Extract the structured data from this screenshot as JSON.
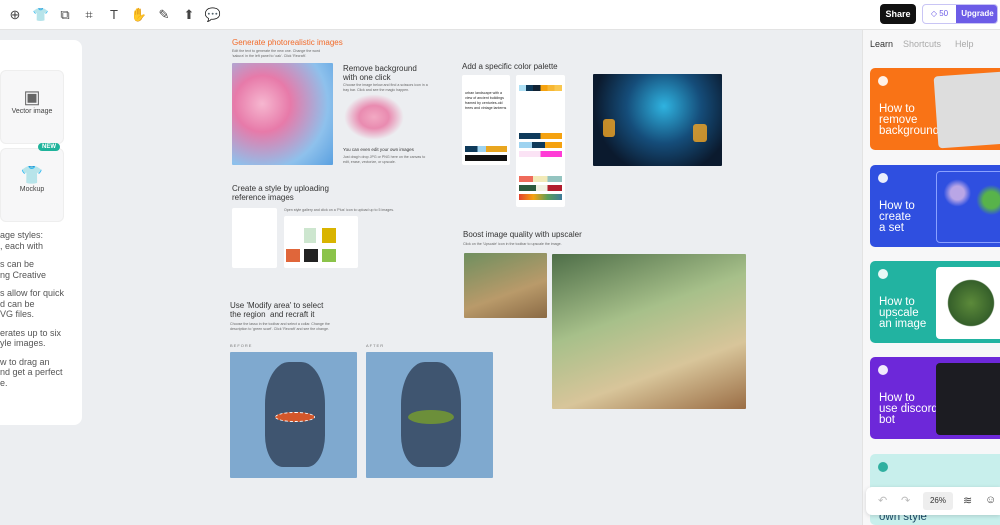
{
  "toolbar": {
    "tools": [
      "ai-image-icon",
      "mockup-icon",
      "shapes-icon",
      "frame-icon",
      "text-icon",
      "hand-icon",
      "brush-icon",
      "upload-image-icon",
      "comment-icon"
    ],
    "share_label": "Share",
    "credits": "50",
    "upgrade_label": "Upgrade"
  },
  "left_panel": {
    "cards": [
      {
        "label": "Vector image",
        "icon": "vector-image-icon"
      },
      {
        "label": "Mockup",
        "icon": "tshirt-icon",
        "badge": "NEW"
      }
    ],
    "texts": [
      "age styles:\n, each with",
      "s can be\nng Creative",
      "s allow for quick\nd can be\nVG files.",
      "erates up to six\nyle images.",
      "w to drag an\nnd get a perfect\ne."
    ]
  },
  "canvas": {
    "photo": {
      "title": "Generate photorealistic images",
      "desc": "Edit the text to generate the new one. Change the word 'sakura' in the left panel to 'oak'. Click 'Recraft'.",
      "title_color": "#f26b2a"
    },
    "remove_bg": {
      "title": "Remove background\nwith one click",
      "desc": "Choose the image below and find a scissors icon in a tray bar. Click and see the magic happen.",
      "edit_title": "You can even edit your own images",
      "edit_desc": "Just drag'n drop JPG or PNG here on the canvas to edit, erase, vectorize, or upscale."
    },
    "style": {
      "title": "Create a style by uploading\nreference images",
      "desc": "Open style gallery and click on a 'Plus' icon to upload up to 5 images."
    },
    "modify": {
      "title": "Use 'Modify area' to select\nthe region  and recraft it",
      "desc": "Choose the lasso in the toolbar and select a collar. Change the description to 'green scarf'. Click 'Recraft' and see the change.",
      "before": "BEFORE",
      "after": "AFTER"
    },
    "palette": {
      "title": "Add a specific color palette",
      "prompt": "urban landscape with a view of ancient buildings framed by centuries-old trees and vintage lanterns"
    },
    "upscaler": {
      "title": "Boost image quality with upscaler",
      "desc": "Click on the 'Upscale' icon in the toolbar to upscale the image."
    }
  },
  "right_panel": {
    "tabs": [
      "Learn",
      "Shortcuts",
      "Help"
    ],
    "active_tab": "Learn",
    "cards": [
      {
        "title": "How to\nremove\nbackground",
        "color": "#f97316"
      },
      {
        "title": "How to\ncreate\na set",
        "color": "#2f4fe0"
      },
      {
        "title": "How to\nupscale\nan image",
        "color": "#22b3a1"
      },
      {
        "title": "How to\nuse discord\nbot",
        "color": "#6d28d9"
      },
      {
        "title": "own style",
        "color": "#c8efec"
      }
    ]
  },
  "bottom_bar": {
    "zoom": "26%"
  }
}
